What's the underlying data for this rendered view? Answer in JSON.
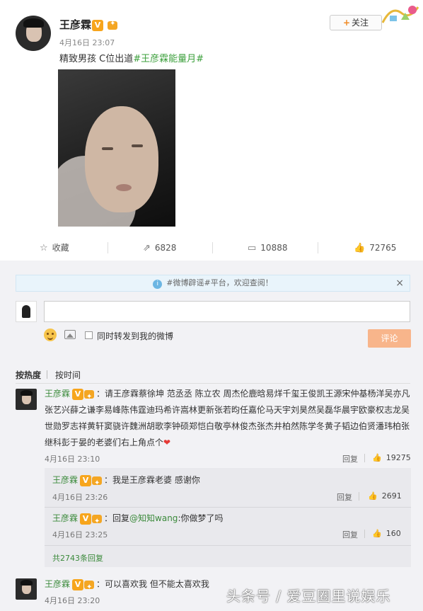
{
  "post": {
    "author": "王彦霖",
    "time": "4月16日 23:07",
    "text_prefix": "精致男孩 C位出道",
    "hashtag": "#王彦霖能量月#",
    "follow_label": "关注",
    "follow_plus": "+"
  },
  "actions": {
    "favorite_label": "收藏",
    "repost_count": "6828",
    "comment_count": "10888",
    "like_count": "72765"
  },
  "notice": {
    "text": "#微博辟谣#平台，欢迎查阅！",
    "close": "×"
  },
  "composer": {
    "checkbox_label": "同时转发到我的微博",
    "submit_label": "评论"
  },
  "sort": {
    "hot": "按热度",
    "time": "按时间"
  },
  "badges": {
    "v": "V"
  },
  "comments": [
    {
      "name": "王彦霖",
      "text_line1": "：请王彦霖蔡徐坤 范丞丞 陈立农 周杰伦鹿晗易烊千玺王俊凯王源宋仲基杨洋吴亦凡",
      "text_line2": "张艺兴薛之谦李易峰陈伟霆迪玛希许嵩林更新张若昀任嘉伦马天宇刘昊然吴磊华晨宇欧豪权志龙吴",
      "text_line3": "世勋罗志祥黄轩窦骁许魏洲胡歌李钟硕郑恺白敬亭林俊杰张杰井柏然陈学冬黄子韬边伯贤潘玮柏张",
      "text_line4": "继科彭于晏的老婆们右上角点个",
      "heart": "❤",
      "time": "4月16日 23:10",
      "reply": "回复",
      "likes": "19275"
    },
    {
      "name": "王彦霖",
      "text": "：我是王彦霖老婆 感谢你",
      "time": "4月16日 23:26",
      "reply": "回复",
      "likes": "2691"
    },
    {
      "name": "王彦霖",
      "text_prefix": "：回复",
      "mention": "@知知wang",
      "text_suffix": ":你做梦了吗",
      "time": "4月16日 23:25",
      "reply": "回复",
      "likes": "160"
    },
    {
      "more": "共2743条回复"
    },
    {
      "name": "王彦霖",
      "text": "：可以喜欢我 但不能太喜欢我",
      "time": "4月16日 23:20"
    }
  ],
  "watermark": "头条号 / 爱豆圈里说娱乐"
}
